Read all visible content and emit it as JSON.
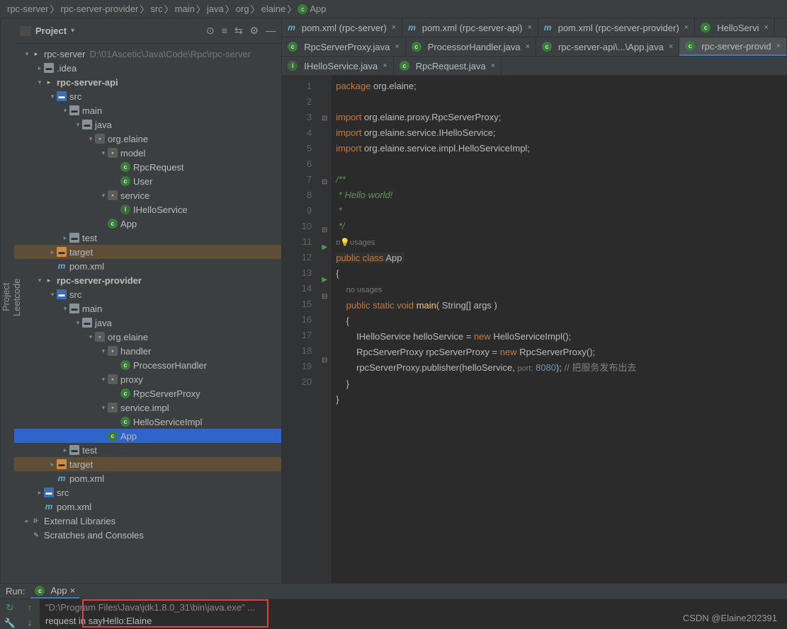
{
  "breadcrumb": [
    "rpc-server",
    "rpc-server-provider",
    "src",
    "main",
    "java",
    "org",
    "elaine",
    "App"
  ],
  "leftGutter": [
    "Project",
    "Leetcode"
  ],
  "projectPanel": {
    "title": "Project"
  },
  "toolbar": {
    "target": "⊙",
    "sel": "≡",
    "expand": "⇆",
    "gear": "⚙",
    "min": "—"
  },
  "tree": [
    {
      "d": 0,
      "a": "▾",
      "i": "mod",
      "t": "rpc-server",
      "p": "D:\\01Ascetic\\Java\\Code\\Rpc\\rpc-server"
    },
    {
      "d": 1,
      "a": "▸",
      "i": "folder",
      "t": ".idea"
    },
    {
      "d": 1,
      "a": "▾",
      "i": "mod",
      "t": "rpc-server-api",
      "b": 1
    },
    {
      "d": 2,
      "a": "▾",
      "i": "folder-blue",
      "t": "src"
    },
    {
      "d": 3,
      "a": "▾",
      "i": "folder",
      "t": "main"
    },
    {
      "d": 4,
      "a": "▾",
      "i": "folder",
      "t": "java"
    },
    {
      "d": 5,
      "a": "▾",
      "i": "pkg",
      "t": "org.elaine"
    },
    {
      "d": 6,
      "a": "▾",
      "i": "pkg",
      "t": "model"
    },
    {
      "d": 7,
      "a": "",
      "i": "cls",
      "t": "RpcRequest"
    },
    {
      "d": 7,
      "a": "",
      "i": "cls",
      "t": "User"
    },
    {
      "d": 6,
      "a": "▾",
      "i": "pkg",
      "t": "service"
    },
    {
      "d": 7,
      "a": "",
      "i": "int",
      "t": "IHelloService"
    },
    {
      "d": 6,
      "a": "",
      "i": "cls",
      "t": "App"
    },
    {
      "d": 3,
      "a": "▸",
      "i": "folder",
      "t": "test"
    },
    {
      "d": 2,
      "a": "▸",
      "i": "folder-orange",
      "t": "target",
      "hl": 1
    },
    {
      "d": 2,
      "a": "",
      "i": "m-ico",
      "t": "pom.xml"
    },
    {
      "d": 1,
      "a": "▾",
      "i": "mod",
      "t": "rpc-server-provider",
      "b": 1
    },
    {
      "d": 2,
      "a": "▾",
      "i": "folder-blue",
      "t": "src"
    },
    {
      "d": 3,
      "a": "▾",
      "i": "folder",
      "t": "main"
    },
    {
      "d": 4,
      "a": "▾",
      "i": "folder",
      "t": "java"
    },
    {
      "d": 5,
      "a": "▾",
      "i": "pkg",
      "t": "org.elaine"
    },
    {
      "d": 6,
      "a": "▾",
      "i": "pkg",
      "t": "handler"
    },
    {
      "d": 7,
      "a": "",
      "i": "cls",
      "t": "ProcessorHandler"
    },
    {
      "d": 6,
      "a": "▾",
      "i": "pkg",
      "t": "proxy"
    },
    {
      "d": 7,
      "a": "",
      "i": "cls",
      "t": "RpcServerProxy"
    },
    {
      "d": 6,
      "a": "▾",
      "i": "pkg",
      "t": "service.impl"
    },
    {
      "d": 7,
      "a": "",
      "i": "cls",
      "t": "HelloServiceImpl"
    },
    {
      "d": 6,
      "a": "",
      "i": "cls",
      "t": "App",
      "sel": 1
    },
    {
      "d": 3,
      "a": "▸",
      "i": "folder",
      "t": "test"
    },
    {
      "d": 2,
      "a": "▸",
      "i": "folder-orange",
      "t": "target",
      "hl": 1
    },
    {
      "d": 2,
      "a": "",
      "i": "m-ico",
      "t": "pom.xml"
    },
    {
      "d": 1,
      "a": "▸",
      "i": "folder-blue",
      "t": "src"
    },
    {
      "d": 1,
      "a": "",
      "i": "m-ico",
      "t": "pom.xml"
    },
    {
      "d": 0,
      "a": "▸",
      "i": "lib",
      "t": "External Libraries"
    },
    {
      "d": 0,
      "a": "",
      "i": "sc",
      "t": "Scratches and Consoles"
    }
  ],
  "tabsRow1": [
    {
      "i": "m-ico",
      "t": "pom.xml (rpc-server)"
    },
    {
      "i": "m-ico",
      "t": "pom.xml (rpc-server-api)"
    },
    {
      "i": "m-ico",
      "t": "pom.xml (rpc-server-provider)"
    },
    {
      "i": "cls",
      "t": "HelloServi"
    }
  ],
  "tabsRow2": [
    {
      "i": "cls",
      "t": "RpcServerProxy.java"
    },
    {
      "i": "cls",
      "t": "ProcessorHandler.java"
    },
    {
      "i": "cls",
      "t": "rpc-server-api\\...\\App.java"
    },
    {
      "i": "cls",
      "t": "rpc-server-provid",
      "active": 1
    }
  ],
  "tabsRow3": [
    {
      "i": "int",
      "t": "IHelloService.java"
    },
    {
      "i": "cls",
      "t": "RpcRequest.java"
    }
  ],
  "code": {
    "pkg": "package",
    "pkgName": "org.elaine",
    "imports": [
      "org.elaine.proxy.RpcServerProxy",
      "org.elaine.service.IHelloService",
      "org.elaine.service.impl.HelloServiceImpl"
    ],
    "doc": [
      "/**",
      " * Hello world!",
      " *",
      " */"
    ],
    "noUsages": "no usages",
    "classDecl": {
      "public": "public",
      "cls": "class",
      "name": "App"
    },
    "main": {
      "public": "public",
      "static": "static",
      "void": "void",
      "name": "main",
      "args": "String[] args"
    },
    "l15": {
      "type": "IHelloService",
      "var": "helloService",
      "new": "new",
      "ctor": "HelloServiceImpl()"
    },
    "l16": {
      "type": "RpcServerProxy",
      "var": "rpcServerProxy",
      "new": "new",
      "ctor": "RpcServerProxy()"
    },
    "l17": {
      "obj": "rpcServerProxy",
      "m": "publisher",
      "arg1": "helloService",
      "hint": "port:",
      "port": "8080",
      "cmt": "// 把服务发布出去"
    }
  },
  "run": {
    "label": "Run:",
    "tab": "App",
    "out": [
      "\"D:\\Program Files\\Java\\jdk1.8.0_31\\bin\\java.exe\" ...",
      "request in sayHello:Elaine"
    ]
  },
  "watermark": "CSDN @Elaine202391"
}
